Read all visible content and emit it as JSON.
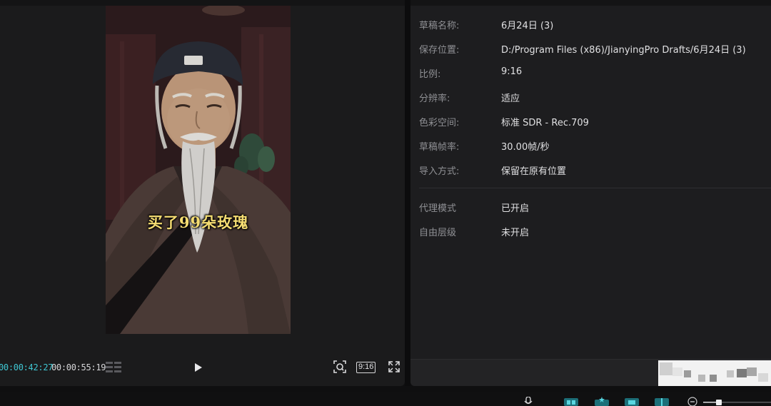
{
  "player": {
    "subtitle": "买了99朵玫瑰",
    "current_time": "00:00:42:27",
    "total_time": "00:00:55:19",
    "ratio_label": "9:16",
    "accent_color": "#3fc6d2"
  },
  "icons": {
    "timeline": "timeline-grid-icon",
    "play": "play-icon",
    "fit": "zoom-fit-icon",
    "fullscreen": "fullscreen-icon",
    "mic": "microphone-icon",
    "toolbar": [
      "split-icon",
      "ai-effect-icon",
      "link-icon",
      "preview-axis-icon",
      "zoom-out-icon"
    ]
  },
  "info": {
    "rows": [
      {
        "label": "草稿名称:",
        "value": "6月24日 (3)"
      },
      {
        "label": "保存位置:",
        "value": "D:/Program Files (x86)/JianyingPro Drafts/6月24日 (3)"
      },
      {
        "label": "比例:",
        "value": "9:16"
      },
      {
        "label": "分辨率:",
        "value": "适应"
      },
      {
        "label": "色彩空间:",
        "value": "标准 SDR - Rec.709"
      },
      {
        "label": "草稿帧率:",
        "value": "30.00帧/秒"
      },
      {
        "label": "导入方式:",
        "value": "保留在原有位置"
      }
    ],
    "extra_rows": [
      {
        "label": "代理模式",
        "value": "已开启"
      },
      {
        "label": "自由层级",
        "value": "未开启"
      }
    ]
  }
}
